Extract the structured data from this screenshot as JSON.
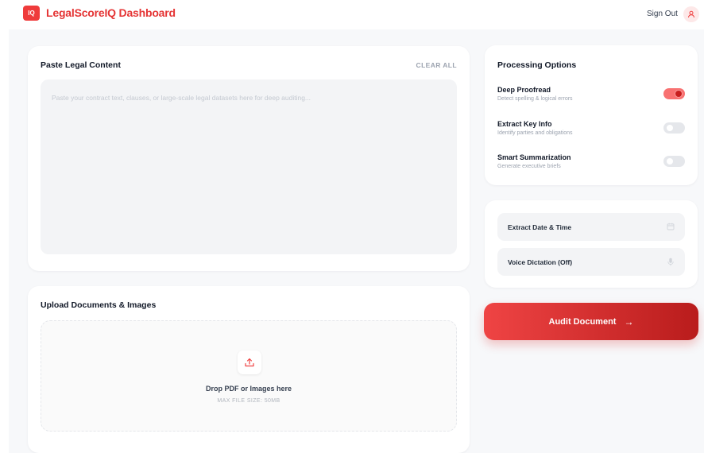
{
  "header": {
    "logo_text": "IQ",
    "title": "LegalScoreIQ Dashboard",
    "sign_out": "Sign Out"
  },
  "paste": {
    "title": "Paste Legal Content",
    "clear_all": "CLEAR ALL",
    "placeholder": "Paste your contract text, clauses, or large-scale legal datasets here for deep auditing..."
  },
  "upload": {
    "title": "Upload Documents & Images",
    "drop_text": "Drop PDF or Images here",
    "max_size": "MAX FILE SIZE: 50MB"
  },
  "options": {
    "title": "Processing Options",
    "items": [
      {
        "title": "Deep Proofread",
        "subtitle": "Detect spelling & logical errors",
        "enabled": true
      },
      {
        "title": "Extract Key Info",
        "subtitle": "Identify parties and obligations",
        "enabled": false
      },
      {
        "title": "Smart Summarization",
        "subtitle": "Generate executive briefs",
        "enabled": false
      }
    ]
  },
  "tools": {
    "extract_date": "Extract Date & Time",
    "voice": "Voice Dictation (Off)"
  },
  "audit": {
    "label": "Audit Document",
    "arrow": "→"
  },
  "colors": {
    "brand": "#e53535",
    "accent_gradient_start": "#ef4444",
    "accent_gradient_end": "#b91c1c",
    "background": "#f7f8fa"
  },
  "icons": {
    "avatar": "user-icon",
    "upload": "upload-icon",
    "calendar": "calendar-icon",
    "microphone": "microphone-icon",
    "arrow": "arrow-right-icon"
  }
}
